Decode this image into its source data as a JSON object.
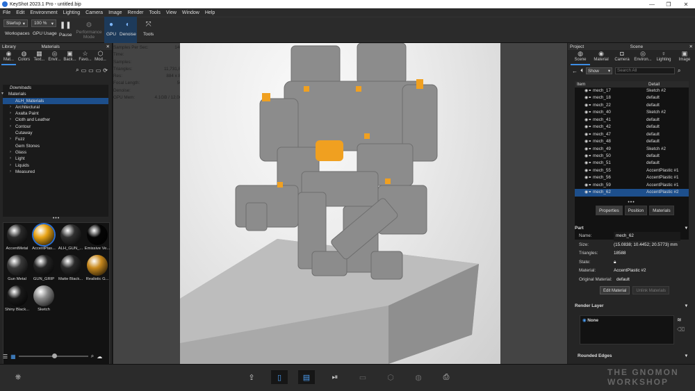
{
  "window": {
    "title": "KeyShot 2023.1 Pro  -  untitled.bip",
    "controls": [
      "—",
      "❐",
      "✕"
    ]
  },
  "menu": [
    "File",
    "Edit",
    "Environment",
    "Lighting",
    "Camera",
    "Image",
    "Render",
    "Tools",
    "View",
    "Window",
    "Help"
  ],
  "toolbar": {
    "workspace_value": "Startup",
    "zoom_value": "100 %",
    "workspaces_label": "Workspaces",
    "gpu_usage_label": "GPU Usage",
    "pause_label": "Pause",
    "performance_label": "Performance Mode",
    "gpu_label": "GPU",
    "denoise_label": "Denoise",
    "tools_label": "Tools"
  },
  "library": {
    "header": "Library",
    "tab_title": "Materials",
    "tabs": [
      "Mat...",
      "Colors",
      "Text...",
      "Envir...",
      "Back...",
      "Favo...",
      "Mod..."
    ],
    "tree": [
      {
        "label": "Downloads",
        "italic": true,
        "arrow": ""
      },
      {
        "label": "Materials",
        "arrow": "▾"
      },
      {
        "label": "ALH_Materials",
        "arrow": "",
        "selected": true
      },
      {
        "label": "Architectural",
        "arrow": "›"
      },
      {
        "label": "Axalta Paint",
        "arrow": "›"
      },
      {
        "label": "Cloth and Leather",
        "arrow": "›"
      },
      {
        "label": "Contour",
        "arrow": "›"
      },
      {
        "label": "Cutaway",
        "arrow": ""
      },
      {
        "label": "Fuzz",
        "arrow": "›"
      },
      {
        "label": "Gem Stones",
        "arrow": ""
      },
      {
        "label": "Glass",
        "arrow": "›"
      },
      {
        "label": "Light",
        "arrow": "›"
      },
      {
        "label": "Liquids",
        "arrow": "›"
      },
      {
        "label": "Measured",
        "arrow": "›"
      }
    ],
    "materials": [
      {
        "name": "AccentMetal",
        "color": "#2a2a2a"
      },
      {
        "name": "AccentPlas...",
        "color": "#e8a316"
      },
      {
        "name": "ALH_GUN_...",
        "color": "#303030"
      },
      {
        "name": "Emissive Ve...",
        "color": "#050505"
      },
      {
        "name": "Gun Metal",
        "color": "#3a3a3a"
      },
      {
        "name": "GUN_GRIP",
        "color": "#242424"
      },
      {
        "name": "Matte Black...",
        "color": "#2a2a2a"
      },
      {
        "name": "Realistic G...",
        "color": "#c98a1e"
      },
      {
        "name": "Shiny Black...",
        "color": "#1a1a1a"
      },
      {
        "name": "Sketch",
        "color": "#8a8a8a"
      }
    ]
  },
  "stats": [
    {
      "k": "Samples Per Sec:",
      "v": "146.6"
    },
    {
      "k": "Time:",
      "v": "0s"
    },
    {
      "k": "Samples:",
      "v": "46"
    },
    {
      "k": "Triangles:",
      "v": "11,731,832"
    },
    {
      "k": "Res:",
      "v": "884 x 884"
    },
    {
      "k": "Focal Length:",
      "v": "50.0"
    },
    {
      "k": "Denoise:",
      "v": "On"
    },
    {
      "k": "GPU Mem:",
      "v": "4.1GB / 12.0GB"
    }
  ],
  "project": {
    "header_left": "Project",
    "header_title": "Scene",
    "tabs": [
      "Scene",
      "Material",
      "Camera",
      "Environ...",
      "Lighting",
      "Image"
    ],
    "show_value": "Show",
    "search_placeholder": "Search All",
    "col_item": "Item",
    "col_detail": "Detail",
    "rows": [
      {
        "item": "mech_17",
        "detail": "Sketch #2"
      },
      {
        "item": "mech_18",
        "detail": "default"
      },
      {
        "item": "mech_22",
        "detail": "default"
      },
      {
        "item": "mech_40",
        "detail": "Sketch #2"
      },
      {
        "item": "mech_41",
        "detail": "default"
      },
      {
        "item": "mech_42",
        "detail": "default"
      },
      {
        "item": "mech_47",
        "detail": "default"
      },
      {
        "item": "mech_48",
        "detail": "default"
      },
      {
        "item": "mech_49",
        "detail": "Sketch #2"
      },
      {
        "item": "mech_50",
        "detail": "default"
      },
      {
        "item": "mech_51",
        "detail": "default"
      },
      {
        "item": "mech_55",
        "detail": "AccentPlastic #1"
      },
      {
        "item": "mech_56",
        "detail": "AccentPlastic #1"
      },
      {
        "item": "mech_59",
        "detail": "AccentPlastic #1"
      },
      {
        "item": "mech_62",
        "detail": "AccentPlastic #2",
        "selected": true
      }
    ],
    "prop_tabs": [
      "Properties",
      "Position",
      "Materials"
    ]
  },
  "part": {
    "section": "Part",
    "name_label": "Name:",
    "name_value": "mech_62",
    "size_label": "Size:",
    "size_value": "(15.0838; 10.4452; 20.5773) mm",
    "triangles_label": "Triangles:",
    "triangles_value": "18588",
    "state_label": "State:",
    "material_label": "Material:",
    "material_value": "AccentPlastic #2",
    "orig_label": "Original Material:",
    "orig_value": "default",
    "edit_btn": "Edit Material",
    "unlink_btn": "Unlink Materials",
    "render_layer_section": "Render Layer",
    "render_layer_value": "None",
    "rounded_edges_section": "Rounded Edges"
  },
  "watermark": {
    "line1": "THE GNOMON",
    "line2": "WORKSHOP"
  }
}
